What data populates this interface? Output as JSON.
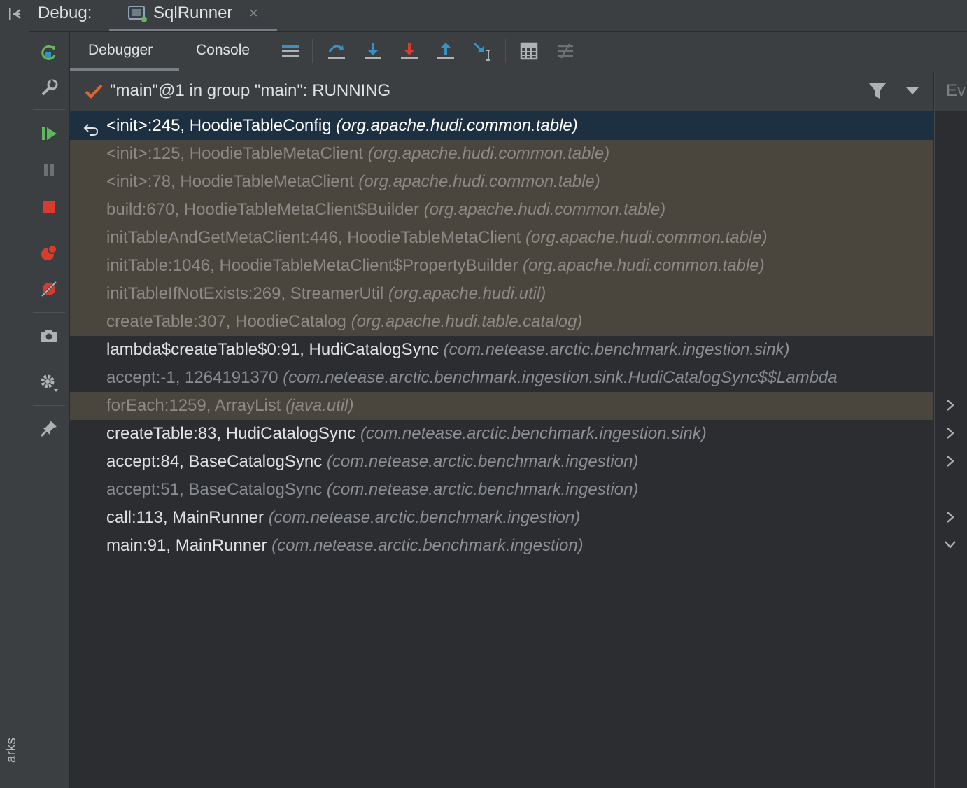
{
  "side_label": "arks",
  "topbar": {
    "debug_label": "Debug:",
    "run_tab": {
      "title": "SqlRunner",
      "close": "×"
    }
  },
  "tabs": {
    "debugger": "Debugger",
    "console": "Console"
  },
  "thread": {
    "text": "\"main\"@1 in group \"main\": RUNNING"
  },
  "eval_panel": {
    "label": "Ev"
  },
  "frames": [
    {
      "method": "<init>:245, HoodieTableConfig",
      "package": "(org.apache.hudi.common.table)",
      "style": "selected"
    },
    {
      "method": "<init>:125, HoodieTableMetaClient",
      "package": "(org.apache.hudi.common.table)",
      "style": "lib"
    },
    {
      "method": "<init>:78, HoodieTableMetaClient",
      "package": "(org.apache.hudi.common.table)",
      "style": "lib"
    },
    {
      "method": "build:670, HoodieTableMetaClient$Builder",
      "package": "(org.apache.hudi.common.table)",
      "style": "lib"
    },
    {
      "method": "initTableAndGetMetaClient:446, HoodieTableMetaClient",
      "package": "(org.apache.hudi.common.table)",
      "style": "lib"
    },
    {
      "method": "initTable:1046, HoodieTableMetaClient$PropertyBuilder",
      "package": "(org.apache.hudi.common.table)",
      "style": "lib"
    },
    {
      "method": "initTableIfNotExists:269, StreamerUtil",
      "package": "(org.apache.hudi.util)",
      "style": "lib"
    },
    {
      "method": "createTable:307, HoodieCatalog",
      "package": "(org.apache.hudi.table.catalog)",
      "style": "lib"
    },
    {
      "method": "lambda$createTable$0:91, HudiCatalogSync",
      "package": "(com.netease.arctic.benchmark.ingestion.sink)",
      "style": "normal"
    },
    {
      "method": "accept:-1, 1264191370",
      "package": "(com.netease.arctic.benchmark.ingestion.sink.HudiCatalogSync$$Lambda",
      "style": "dim"
    },
    {
      "method": "forEach:1259, ArrayList",
      "package": "(java.util)",
      "style": "lib"
    },
    {
      "method": "createTable:83, HudiCatalogSync",
      "package": "(com.netease.arctic.benchmark.ingestion.sink)",
      "style": "normal"
    },
    {
      "method": "accept:84, BaseCatalogSync",
      "package": "(com.netease.arctic.benchmark.ingestion)",
      "style": "normal"
    },
    {
      "method": "accept:51, BaseCatalogSync",
      "package": "(com.netease.arctic.benchmark.ingestion)",
      "style": "dim"
    },
    {
      "method": "call:113, MainRunner",
      "package": "(com.netease.arctic.benchmark.ingestion)",
      "style": "normal"
    },
    {
      "method": "main:91, MainRunner",
      "package": "(com.netease.arctic.benchmark.ingestion)",
      "style": "normal"
    }
  ],
  "colors": {
    "selected_bg": "#1d3041",
    "library_bg": "#4a453d",
    "resume_green": "#5fb85c",
    "stop_red": "#db3b2c",
    "step_blue": "#3592c4"
  }
}
